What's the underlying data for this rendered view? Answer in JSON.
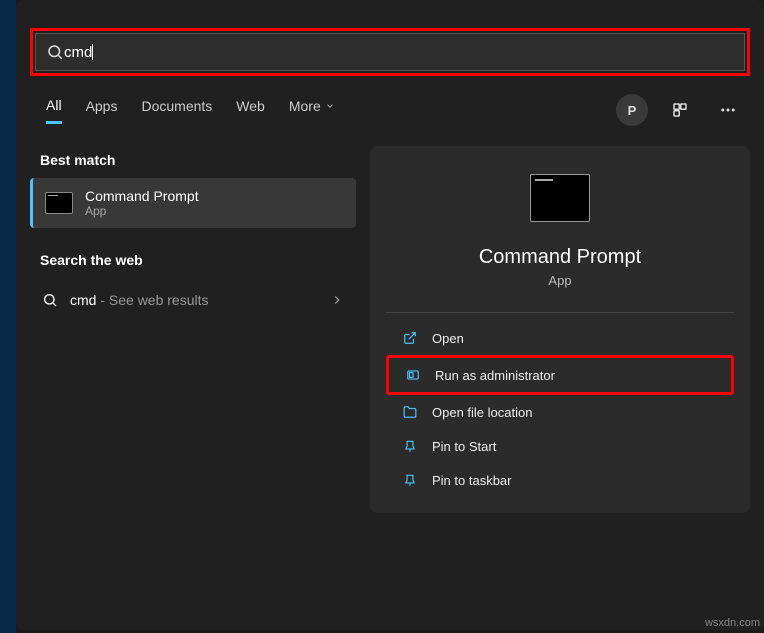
{
  "search": {
    "value": "cmd"
  },
  "tabs": {
    "all": "All",
    "apps": "Apps",
    "documents": "Documents",
    "web": "Web",
    "more": "More"
  },
  "header": {
    "user_initial": "P"
  },
  "left": {
    "best_match": "Best match",
    "result": {
      "title": "Command Prompt",
      "subtitle": "App"
    },
    "search_web": "Search the web",
    "web_item": {
      "term": "cmd",
      "suffix": " - See web results"
    }
  },
  "right": {
    "title": "Command Prompt",
    "subtitle": "App",
    "actions": {
      "open": "Open",
      "run_admin": "Run as administrator",
      "open_loc": "Open file location",
      "pin_start": "Pin to Start",
      "pin_taskbar": "Pin to taskbar"
    }
  },
  "watermark": "wsxdn.com"
}
